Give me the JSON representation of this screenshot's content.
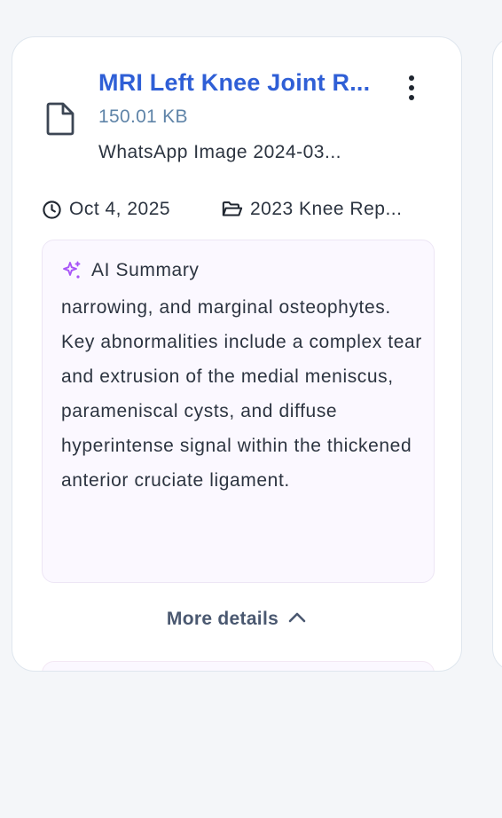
{
  "document_card": {
    "title": "MRI Left Knee Joint R...",
    "file_size": "150.01 KB",
    "source_filename": "WhatsApp Image 2024-03...",
    "date": "Oct 4, 2025",
    "folder": "2023 Knee Rep...",
    "icons": {
      "file": "file-icon",
      "menu": "more-vertical-icon",
      "clock": "clock-icon",
      "folder": "folder-open-icon",
      "sparkle": "sparkles-icon",
      "chevron": "chevron-up-icon"
    },
    "ai_summary": {
      "heading": "AI Summary",
      "text": "narrowing, and marginal osteophytes. Key abnormalities include a complex tear and extrusion of the medial meniscus, parameniscal cysts, and diffuse hyperintense signal within the thickened anterior cruciate ligament."
    },
    "more_details_label": "More details"
  },
  "colors": {
    "title": "#2f5fd6",
    "size": "#5f84a8",
    "text": "#2c3440",
    "sparkle": "#a855f7",
    "summary_bg": "#fbf8ff"
  }
}
